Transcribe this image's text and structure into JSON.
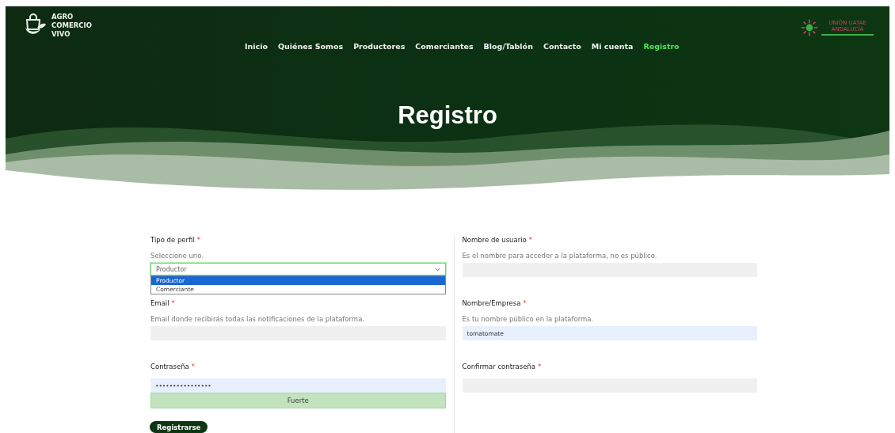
{
  "brand": {
    "lines": [
      "AGRO",
      "COMERCIO",
      "VIVO"
    ]
  },
  "nav": [
    {
      "label": "Inicio",
      "selected": false
    },
    {
      "label": "Quiénes Somos",
      "selected": false
    },
    {
      "label": "Productores",
      "selected": false
    },
    {
      "label": "Comerciantes",
      "selected": false
    },
    {
      "label": "Blog/Tablón",
      "selected": false
    },
    {
      "label": "Contacto",
      "selected": false
    },
    {
      "label": "Mi cuenta",
      "selected": false
    },
    {
      "label": "Registro",
      "selected": true
    }
  ],
  "partner": {
    "lines": [
      "UNIÓN UATAE",
      "ANDALUCÍA"
    ]
  },
  "page_title": "Registro",
  "form": {
    "left": [
      {
        "kind": "select",
        "label": "Tipo de perfil",
        "required_mark": "*",
        "hint": "Seleccione uno.",
        "value": "Productor",
        "expanded": true,
        "options": [
          {
            "label": "Productor",
            "selected": true
          },
          {
            "label": "Comerciante",
            "selected": false
          }
        ]
      },
      {
        "kind": "input",
        "label": "Email",
        "required_mark": "*",
        "hint": "Email donde recibirás todas las notificaciones de la plataforma.",
        "autofilled": false
      },
      {
        "kind": "input",
        "label": "Contraseña",
        "required_mark": "*",
        "value": "••••••••••••••••",
        "autofilled": true,
        "strength": {
          "label": "Fuerte",
          "level": 1
        }
      }
    ],
    "right": [
      {
        "kind": "input",
        "label": "Nombre de usuario",
        "required_mark": "*",
        "hint": "Es el nombre para acceder a la plataforma, no es público.",
        "autofilled": false
      },
      {
        "kind": "input",
        "label": "Nombre/Empresa",
        "required_mark": "*",
        "hint": "Es tu nombre público en la plataforma.",
        "value": "tomatomate",
        "autofilled": true
      },
      {
        "kind": "input",
        "label": "Confirmar contraseña",
        "required_mark": "*",
        "autofilled": false
      }
    ]
  },
  "submit": "Registrarse"
}
